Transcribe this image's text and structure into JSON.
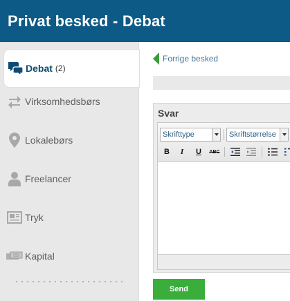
{
  "header": {
    "title": "Privat besked - Debat"
  },
  "sidebar": {
    "items": [
      {
        "label": "Debat",
        "count": "(2)",
        "icon": "chat-bubbles-icon",
        "active": true
      },
      {
        "label": "Virksomhedsbørs",
        "icon": "transfer-arrows-icon"
      },
      {
        "label": "Lokalebørs",
        "icon": "map-pin-icon"
      },
      {
        "label": "Freelancer",
        "icon": "person-icon"
      },
      {
        "label": "Tryk",
        "icon": "newspaper-icon"
      },
      {
        "label": "Kapital",
        "icon": "money-icon"
      }
    ]
  },
  "main": {
    "back_link": "Forrige besked",
    "reply": {
      "title": "Svar",
      "toolbar": {
        "font_family": "Skrifttype",
        "font_size": "Skriftstørrelse",
        "bold": "B",
        "italic": "I",
        "underline": "U",
        "strikethrough": "ABC"
      },
      "body": ""
    },
    "send_label": "Send"
  },
  "colors": {
    "header_bg": "#0d5a86",
    "accent_green": "#3aae3a",
    "link_blue": "#4a7896",
    "active_nav_text": "#0d4b72"
  }
}
